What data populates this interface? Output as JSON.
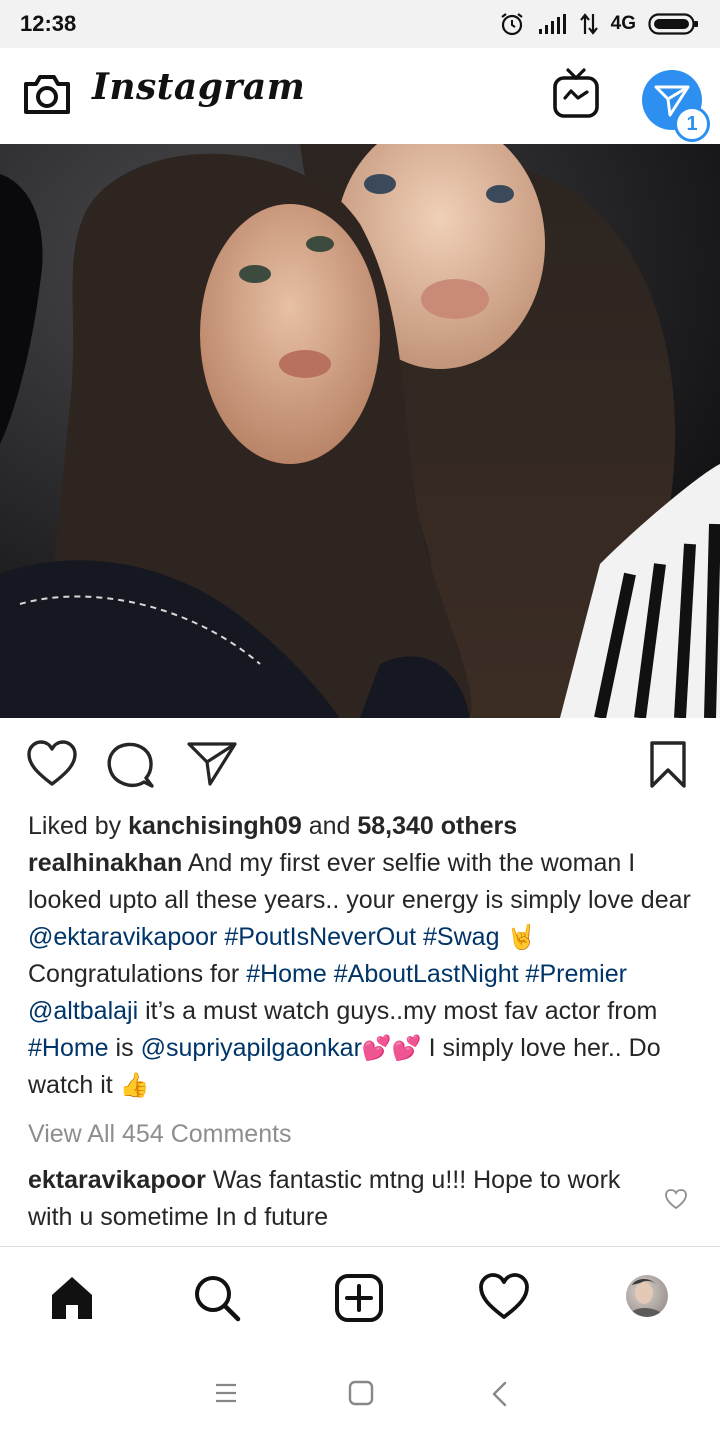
{
  "status_bar": {
    "time": "12:38",
    "network": "4G"
  },
  "app_bar": {
    "title": "Instagram",
    "direct_badge": "1"
  },
  "post": {
    "likes": {
      "prefix": "Liked by",
      "user": "kanchisingh09",
      "joiner": "and",
      "count": "58,340 others"
    },
    "caption": {
      "author": "realhinakhan",
      "part1": "And my first ever selfie with the woman I looked upto all these years.. your energy is simply love dear",
      "mention1": "@ektaravikapoor",
      "tag1": "#PoutIsNeverOut",
      "tag2": "#Swag",
      "emoji1": "🤘",
      "part2": "Congratulations for",
      "tag3": "#Home",
      "tag4": "#AboutLastNight",
      "tag5": "#Premier",
      "mention2": "@altbalaji",
      "part3": "it’s a must watch guys..my most fav actor from",
      "tag6": "#Home",
      "part4": "is",
      "mention3": "@supriyapilgaonkar",
      "emoji2": "💕💕",
      "part5": "I simply love her.. Do watch it",
      "emoji3": "👍"
    },
    "view_comments": "View All 454 Comments",
    "comment": {
      "author": "ektaravikapoor",
      "text": "Was fantastic mtng u!!! Hope to work with u sometime In d future"
    }
  },
  "icons": {
    "status": [
      "alarm-icon",
      "signal-icon",
      "data-arrows-icon",
      "battery-icon"
    ],
    "app_bar": [
      "camera-icon",
      "igtv-icon",
      "direct-message-icon"
    ],
    "post_actions": [
      "heart-icon",
      "comment-icon",
      "share-icon",
      "bookmark-icon"
    ],
    "bottom_nav": [
      "home-icon",
      "search-icon",
      "add-post-icon",
      "activity-heart-icon",
      "profile-avatar"
    ],
    "system_nav": [
      "menu-icon",
      "home-square-icon",
      "back-icon"
    ]
  },
  "colors": {
    "accent_blue": "#2d8ff0",
    "link": "#003569",
    "muted": "#8e8e8e",
    "text": "#262626"
  }
}
